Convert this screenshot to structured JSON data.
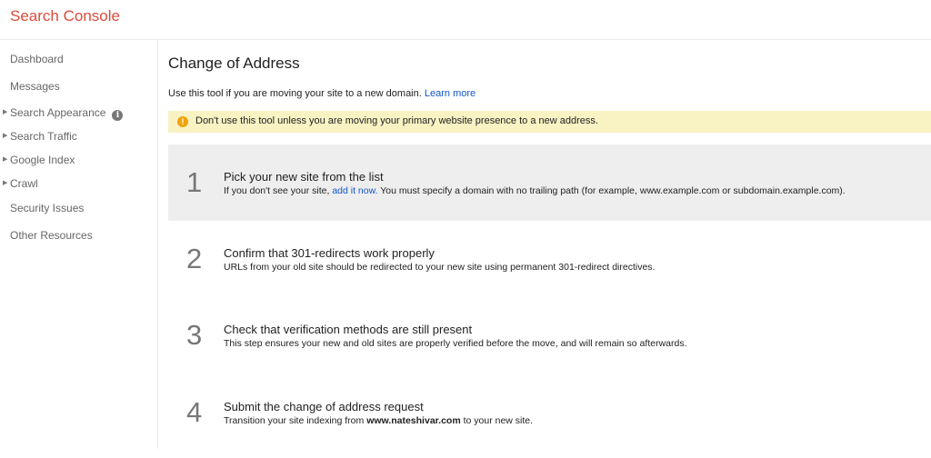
{
  "app": {
    "title": "Search Console",
    "brand_color": "#dd4b39"
  },
  "sidebar": {
    "items": [
      {
        "label": "Dashboard",
        "expandable": false
      },
      {
        "label": "Messages",
        "expandable": false
      },
      {
        "label": "Search Appearance",
        "expandable": true,
        "icon": "info-icon"
      },
      {
        "label": "Search Traffic",
        "expandable": true
      },
      {
        "label": "Google Index",
        "expandable": true
      },
      {
        "label": "Crawl",
        "expandable": true
      },
      {
        "label": "Security Issues",
        "expandable": false
      },
      {
        "label": "Other Resources",
        "expandable": false
      }
    ]
  },
  "main": {
    "title": "Change of Address",
    "intro": "Use this tool if you are moving your site to a new domain.",
    "learn_more": "Learn more",
    "warning": {
      "icon": "exclamation-icon",
      "text": "Don't use this tool unless you are moving your primary website presence to a new address.",
      "background": "#f9f2c3"
    },
    "steps": [
      {
        "number": "1",
        "title": "Pick your new site from the list",
        "desc_before": "If you don't see your site,",
        "link": "add it now.",
        "desc_after": "You must specify a domain with no trailing path (for example, www.example.com or subdomain.example.com).",
        "active": true
      },
      {
        "number": "2",
        "title": "Confirm that 301-redirects work properly",
        "desc": "URLs from your old site should be redirected to your new site using permanent 301-redirect directives."
      },
      {
        "number": "3",
        "title": "Check that verification methods are still present",
        "desc": "This step ensures your new and old sites are properly verified before the move, and will remain so afterwards."
      },
      {
        "number": "4",
        "title": "Submit the change of address request",
        "desc_before": "Transition your site indexing from",
        "domain": "www.nateshivar.com",
        "desc_after": "to your new site."
      }
    ]
  }
}
